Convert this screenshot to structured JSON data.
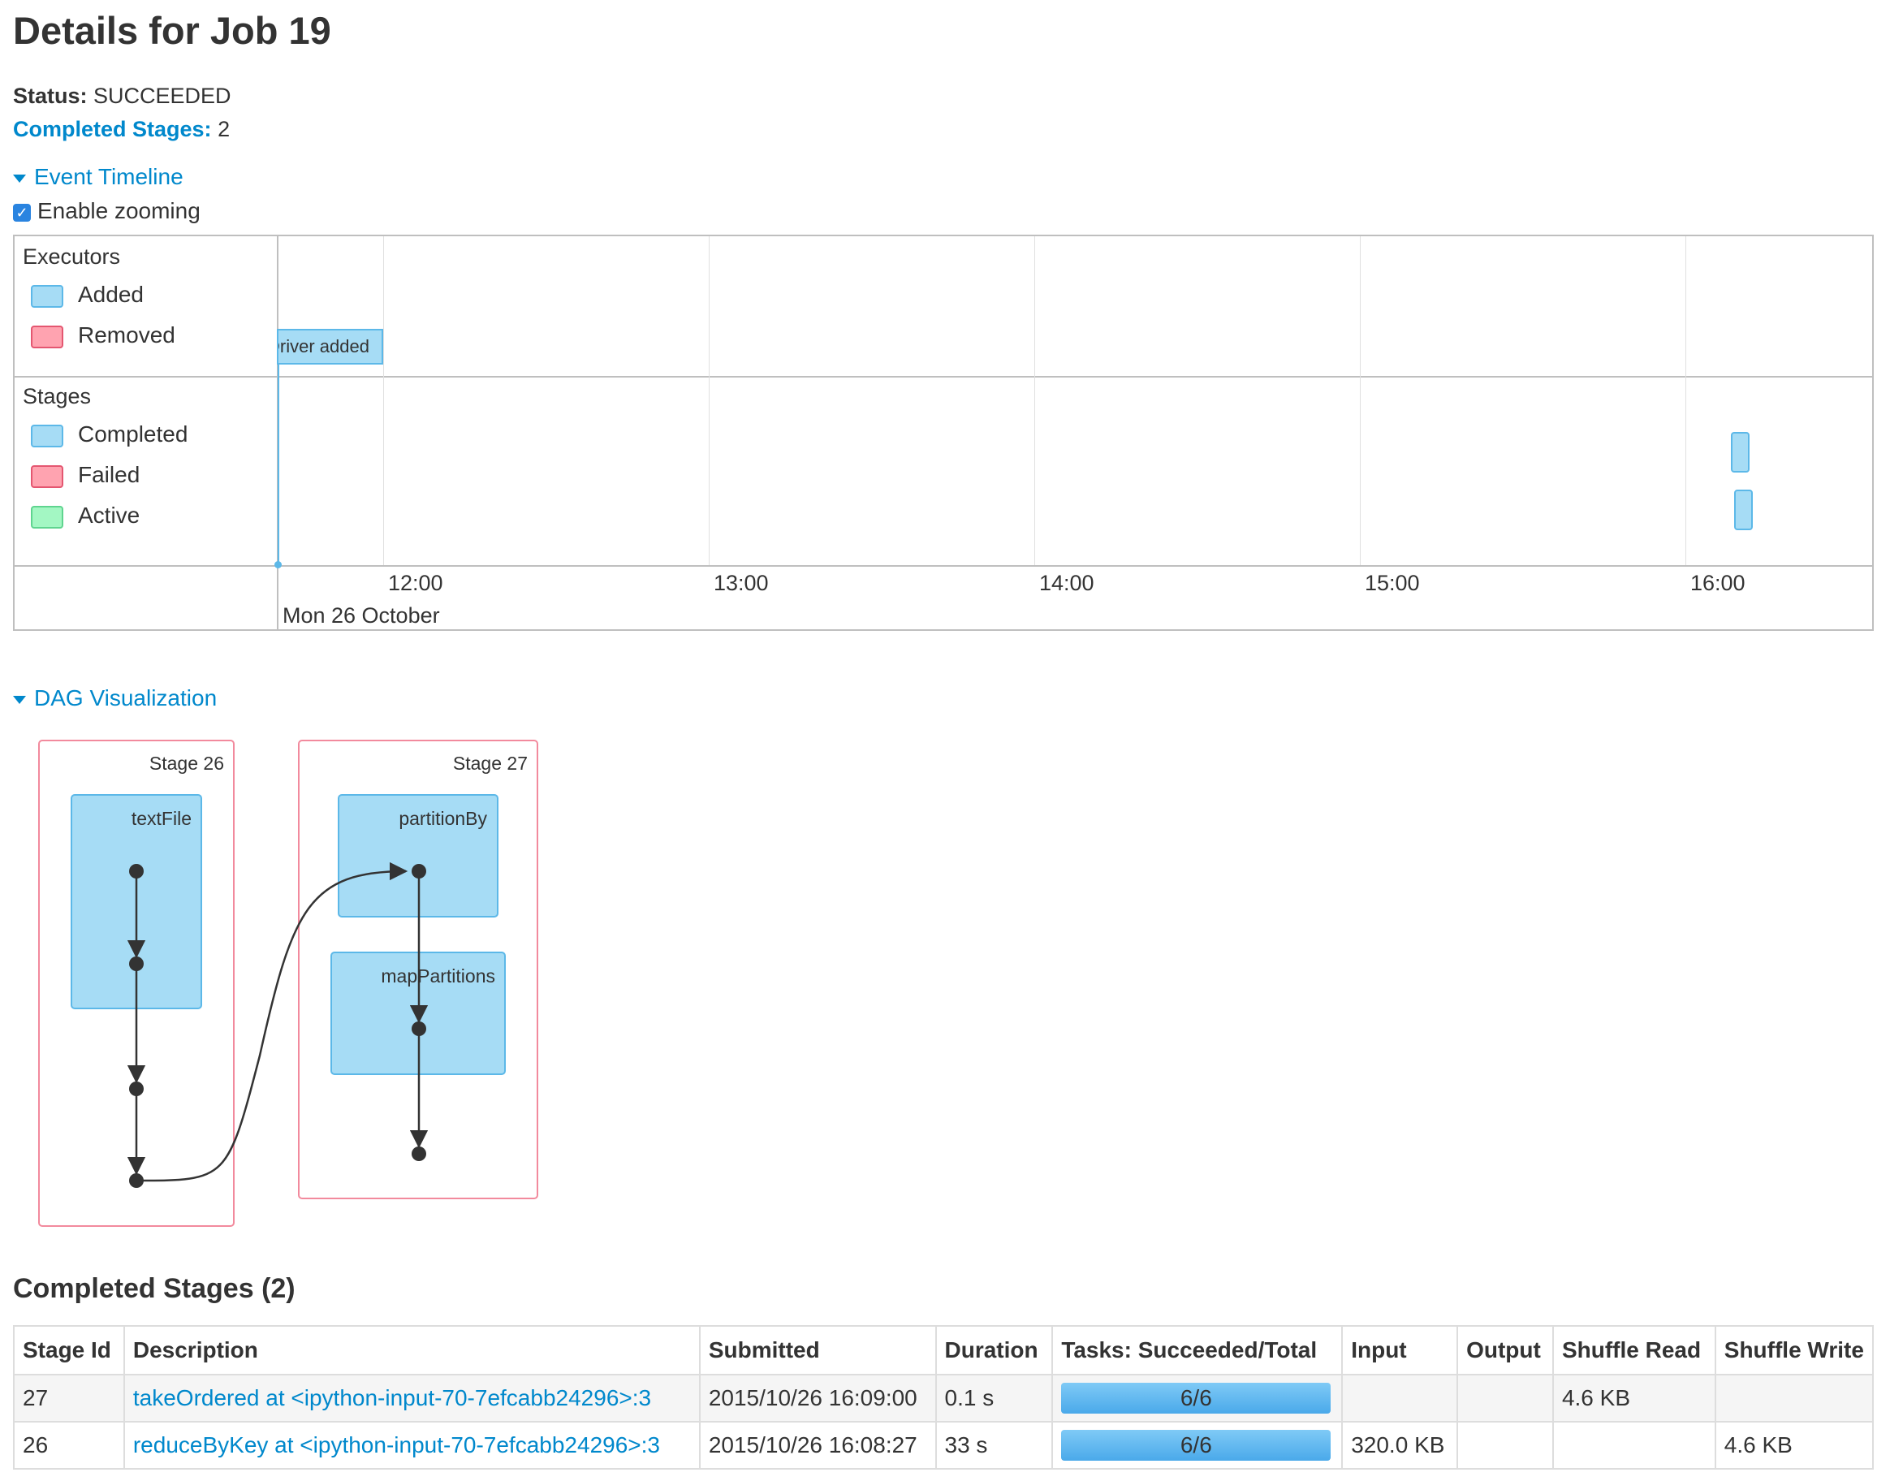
{
  "page": {
    "title": "Details for Job 19"
  },
  "summary": {
    "status_label": "Status:",
    "status_value": "SUCCEEDED",
    "completed_label": "Completed Stages:",
    "completed_value": "2"
  },
  "timeline": {
    "toggle_label": "Event Timeline",
    "zoom_label": "Enable zooming",
    "zoom_checked": true,
    "executors_title": "Executors",
    "executors_legend": [
      "Added",
      "Removed"
    ],
    "stages_title": "Stages",
    "stages_legend": [
      "Completed",
      "Failed",
      "Active"
    ],
    "executor_event": "Driver added",
    "ticks": [
      "12:00",
      "13:00",
      "14:00",
      "15:00",
      "16:00"
    ],
    "axis_date": "Mon 26 October",
    "colors": {
      "added": "#a6dcf5",
      "removed": "#ffa3b0",
      "active": "#a3f7c3"
    }
  },
  "dag": {
    "toggle_label": "DAG Visualization",
    "stages": [
      {
        "label": "Stage 26",
        "ops": [
          "textFile"
        ]
      },
      {
        "label": "Stage 27",
        "ops": [
          "partitionBy",
          "mapPartitions"
        ]
      }
    ]
  },
  "stages_table": {
    "heading": "Completed Stages (2)",
    "columns": [
      "Stage Id",
      "Description",
      "Submitted",
      "Duration",
      "Tasks: Succeeded/Total",
      "Input",
      "Output",
      "Shuffle Read",
      "Shuffle Write"
    ],
    "rows": [
      {
        "id": "27",
        "description": "takeOrdered at <ipython-input-70-7efcabb24296>:3",
        "submitted": "2015/10/26 16:09:00",
        "duration": "0.1 s",
        "tasks": "6/6",
        "tasks_fraction": 1.0,
        "input": "",
        "output": "",
        "shuffle_read": "4.6 KB",
        "shuffle_write": ""
      },
      {
        "id": "26",
        "description": "reduceByKey at <ipython-input-70-7efcabb24296>:3",
        "submitted": "2015/10/26 16:08:27",
        "duration": "33 s",
        "tasks": "6/6",
        "tasks_fraction": 1.0,
        "input": "320.0 KB",
        "output": "",
        "shuffle_read": "",
        "shuffle_write": "4.6 KB"
      }
    ]
  }
}
